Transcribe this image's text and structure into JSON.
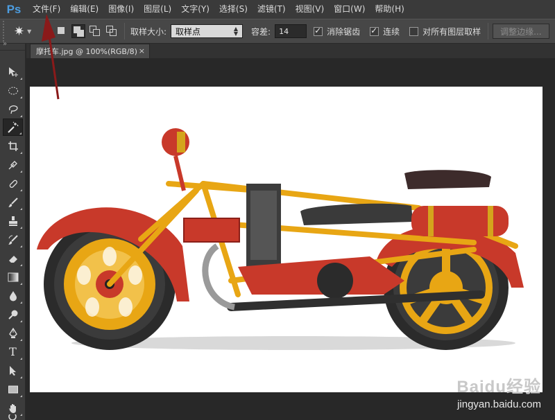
{
  "app": {
    "logo": "Ps"
  },
  "menu": [
    "文件(F)",
    "编辑(E)",
    "图像(I)",
    "图层(L)",
    "文字(Y)",
    "选择(S)",
    "滤镜(T)",
    "视图(V)",
    "窗口(W)",
    "帮助(H)"
  ],
  "options": {
    "tool_icon": "magic-wand-icon",
    "sample_size_label": "取样大小:",
    "sample_size_value": "取样点",
    "tolerance_label": "容差:",
    "tolerance_value": "14",
    "anti_alias_label": "消除锯齿",
    "anti_alias_checked": true,
    "contiguous_label": "连续",
    "contiguous_checked": true,
    "sample_all_layers_label": "对所有图层取样",
    "sample_all_layers_checked": false,
    "refine_edge_label": "调整边缘..."
  },
  "document": {
    "tab_title": "摩托车.jpg @ 100%(RGB/8)",
    "close_glyph": "×"
  },
  "tools": [
    "move-tool",
    "marquee-tool",
    "lasso-tool",
    "magic-wand-tool",
    "crop-tool",
    "eyedropper-tool",
    "healing-brush-tool",
    "brush-tool",
    "clone-stamp-tool",
    "history-brush-tool",
    "eraser-tool",
    "gradient-tool",
    "blur-tool",
    "dodge-tool",
    "pen-tool",
    "type-tool",
    "path-selection-tool",
    "rectangle-tool",
    "hand-tool",
    "zoom-tool"
  ],
  "watermark": {
    "logo": "Baidu经验",
    "url": "jingyan.baidu.com"
  },
  "colors": {
    "menubar": "#3a3a3a",
    "optionsbar": "#474747",
    "canvas": "#ffffff",
    "arrow": "#8a1a1a",
    "frame_yellow": "#e8a614",
    "body_red": "#c8392a"
  }
}
